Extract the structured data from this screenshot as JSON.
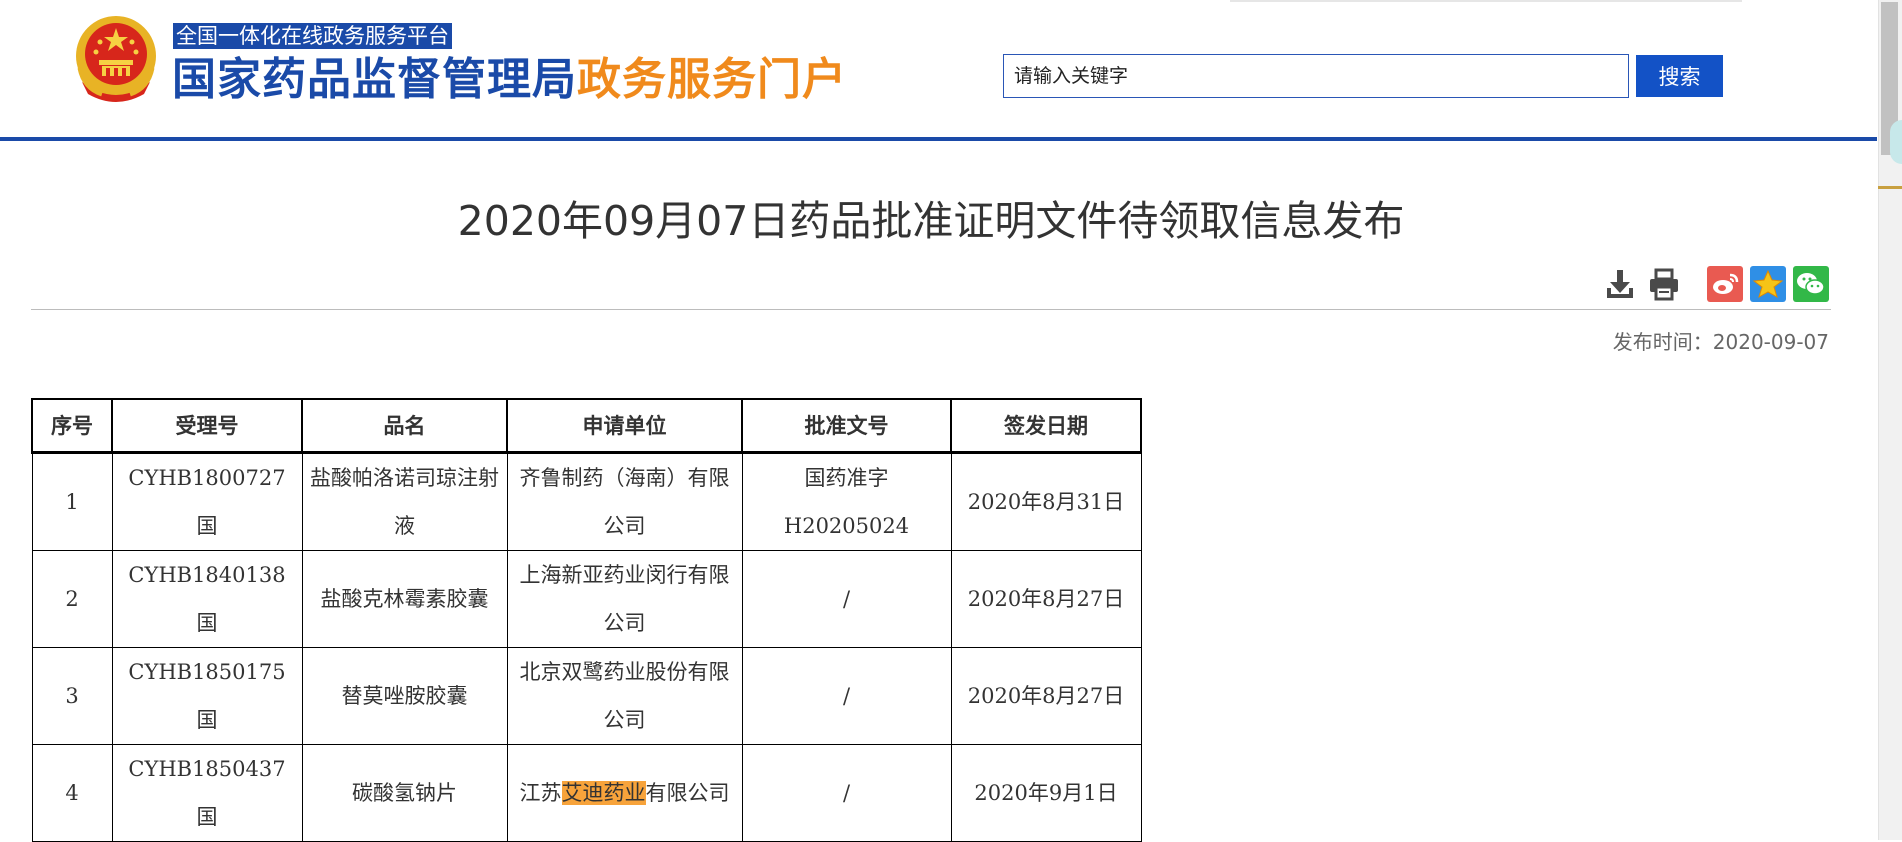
{
  "header": {
    "platform_label": "全国一体化在线政务服务平台",
    "site_title_part1": "国家药品监督管理局",
    "site_title_part2": "政务服务门户",
    "search_placeholder": "请输入关键字",
    "search_button": "搜索"
  },
  "article": {
    "title": "2020年09月07日药品批准证明文件待领取信息发布",
    "publish_time_label": "发布时间：",
    "publish_time": "2020-09-07",
    "icons": [
      "download-icon",
      "print-icon",
      "weibo-share-icon",
      "favorite-star-icon",
      "wechat-share-icon"
    ]
  },
  "table": {
    "headers": [
      "序号",
      "受理号",
      "品名",
      "申请单位",
      "批准文号",
      "签发日期"
    ],
    "rows": [
      {
        "no": "1",
        "accept_no": "CYHB1800727国",
        "name": "盐酸帕洛诺司琼注射液",
        "applicant": "齐鲁制药（海南）有限公司",
        "approval_no": "国药准字H20205024",
        "date": "2020年8月31日"
      },
      {
        "no": "2",
        "accept_no": "CYHB1840138国",
        "name": "盐酸克林霉素胶囊",
        "applicant": "上海新亚药业闵行有限公司",
        "approval_no": "/",
        "date": "2020年8月27日"
      },
      {
        "no": "3",
        "accept_no": "CYHB1850175国",
        "name": "替莫唑胺胶囊",
        "applicant": "北京双鹭药业股份有限公司",
        "approval_no": "/",
        "date": "2020年8月27日"
      },
      {
        "no": "4",
        "accept_no": "CYHB1850437国",
        "name": "碳酸氢钠片",
        "applicant_prefix": "江苏",
        "applicant_highlight": "艾迪药业",
        "applicant_suffix": "有限公司",
        "approval_no": "/",
        "date": "2020年9月1日"
      }
    ]
  },
  "colors": {
    "brand_blue": "#1a4aa8",
    "brand_orange": "#f08a1c",
    "search_button": "#1352c6",
    "highlight": "#f7a33b"
  }
}
